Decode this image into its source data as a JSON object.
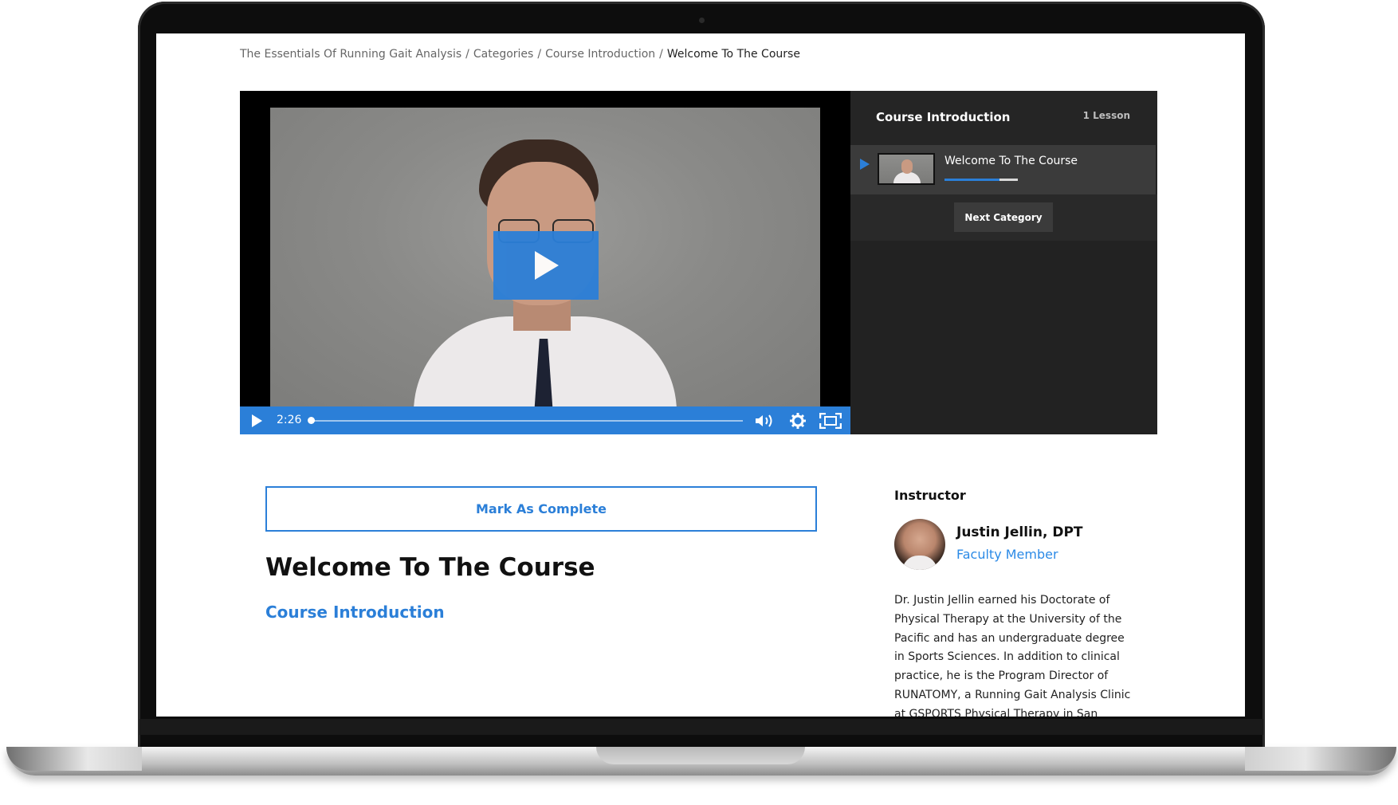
{
  "breadcrumb": {
    "items": [
      "The Essentials Of Running Gait Analysis",
      "Categories",
      "Course Introduction"
    ],
    "separator": "/",
    "current": "Welcome To The Course"
  },
  "player": {
    "time": "2:26",
    "progress_fraction": 0.01,
    "accent_color": "#2b7fd8"
  },
  "playlist": {
    "title": "Course Introduction",
    "count": "1 Lesson",
    "items": [
      {
        "label": "Welcome To The Course",
        "progress_fraction": 0.75
      }
    ],
    "next_button": "Next Category"
  },
  "lesson": {
    "mark_complete": "Mark As Complete",
    "title": "Welcome To The Course",
    "category": "Course Introduction"
  },
  "instructor": {
    "heading": "Instructor",
    "name": "Justin Jellin, DPT",
    "role": "Faculty Member",
    "bio": "Dr. Justin Jellin earned his Doctorate of Physical Therapy at the University of the Pacific and has an undergraduate degree in Sports Sciences. In addition to clinical practice, he is the Program Director of RUNATOMY, a Running Gait Analysis Clinic at GSPORTS Physical Therapy in San"
  }
}
